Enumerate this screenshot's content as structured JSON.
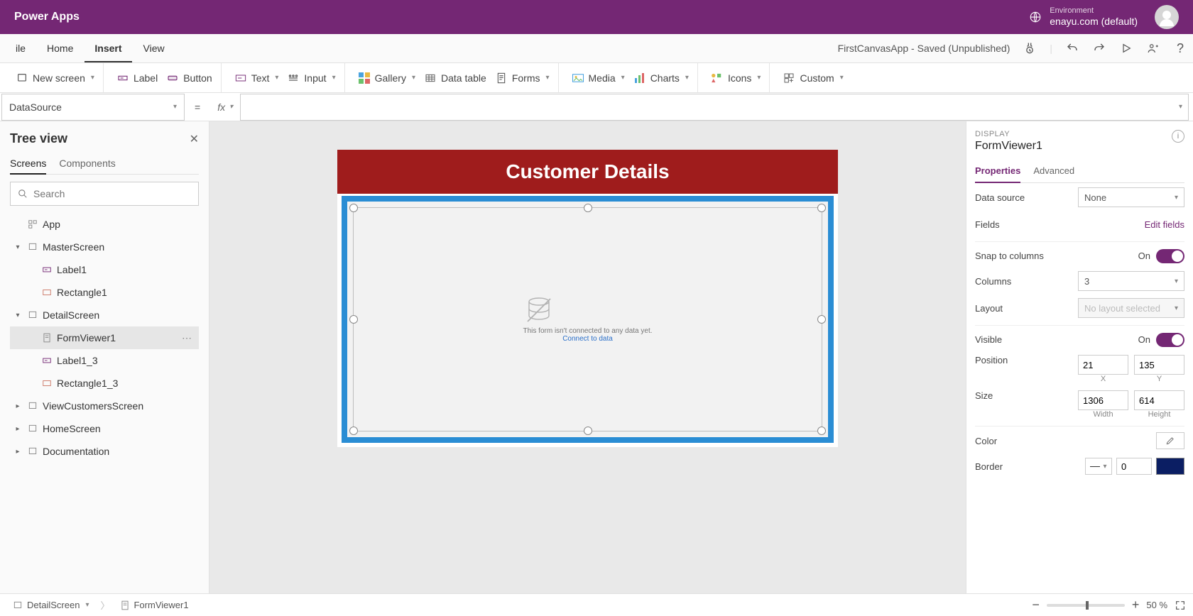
{
  "header": {
    "appName": "Power Apps",
    "env_label": "Environment",
    "env_name": "enayu.com (default)"
  },
  "menubar": {
    "items": [
      "ile",
      "Home",
      "Insert",
      "View"
    ],
    "activeIndex": 2,
    "status": "FirstCanvasApp - Saved (Unpublished)"
  },
  "ribbon": {
    "newScreen": "New screen",
    "label": "Label",
    "button": "Button",
    "text": "Text",
    "input": "Input",
    "gallery": "Gallery",
    "dataTable": "Data table",
    "forms": "Forms",
    "media": "Media",
    "charts": "Charts",
    "icons": "Icons",
    "custom": "Custom"
  },
  "formula": {
    "property": "DataSource",
    "fx": "fx"
  },
  "treeview": {
    "title": "Tree view",
    "tabs": [
      "Screens",
      "Components"
    ],
    "activeTab": 0,
    "searchPlaceholder": "Search",
    "app": "App",
    "nodes": {
      "master": "MasterScreen",
      "label1": "Label1",
      "rect1": "Rectangle1",
      "detail": "DetailScreen",
      "formviewer1": "FormViewer1",
      "label13": "Label1_3",
      "rect13": "Rectangle1_3",
      "viewcust": "ViewCustomersScreen",
      "home": "HomeScreen",
      "docs": "Documentation"
    }
  },
  "canvas": {
    "screenTitle": "Customer Details",
    "emptyMsg": "This form isn't connected to any data yet.",
    "emptyLink": "Connect to data"
  },
  "props": {
    "display": "DISPLAY",
    "name": "FormViewer1",
    "tabs": [
      "Properties",
      "Advanced"
    ],
    "activeTab": 0,
    "dataSourceLabel": "Data source",
    "dataSourceValue": "None",
    "fieldsLabel": "Fields",
    "editFields": "Edit fields",
    "snapLabel": "Snap to columns",
    "snapValue": "On",
    "columnsLabel": "Columns",
    "columnsValue": "3",
    "layoutLabel": "Layout",
    "layoutValue": "No layout selected",
    "visibleLabel": "Visible",
    "visibleValue": "On",
    "positionLabel": "Position",
    "positionX": "21",
    "positionY": "135",
    "xLabel": "X",
    "yLabel": "Y",
    "sizeLabel": "Size",
    "sizeW": "1306",
    "sizeH": "614",
    "widthLabel": "Width",
    "heightLabel": "Height",
    "colorLabel": "Color",
    "borderLabel": "Border",
    "borderWidth": "0",
    "borderColor": "#0b1e63"
  },
  "footer": {
    "crumb1": "DetailScreen",
    "crumb2": "FormViewer1",
    "zoom": "50",
    "pct": "%"
  }
}
